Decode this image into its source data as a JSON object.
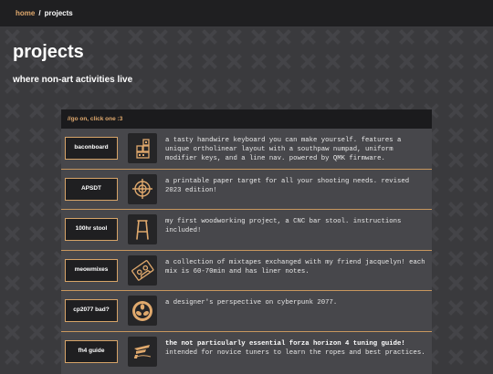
{
  "breadcrumb": {
    "home": "home",
    "separator": "/",
    "current": "projects"
  },
  "header": {
    "title": "projects",
    "subtitle": "where non-art activities live"
  },
  "panel": {
    "header": "//go on, click one :3",
    "projects": [
      {
        "label": "baconboard",
        "icon": "keyboard-keycaps-icon",
        "title": "",
        "description": "a tasty handwire keyboard you can make yourself. features a unique ortholinear layout with a southpaw numpad, uniform modifier keys, and a line nav. powered by QMK firmware."
      },
      {
        "label": "APSDT",
        "icon": "crosshair-target-icon",
        "title": "",
        "description": "a printable paper target for all your shooting needs. revised 2023 edition!"
      },
      {
        "label": "100hr stool",
        "icon": "bar-stool-icon",
        "title": "",
        "description": "my first woodworking project, a CNC bar stool. instructions included!"
      },
      {
        "label": "meowmixes",
        "icon": "cassette-tape-icon",
        "title": "",
        "description": "a collection of mixtapes exchanged with my friend jacquelyn! each mix is 60-70min and has liner notes."
      },
      {
        "label": "cp2077 bad?",
        "icon": "arasaka-logo-icon",
        "title": "",
        "description": "a designer's perspective on cyberpunk 2077."
      },
      {
        "label": "fh4 guide",
        "icon": "forza-horizon-logo-icon",
        "title": "the not particularly essential forza horizon 4 tuning guide!",
        "description": "intended for novice tuners to learn the ropes and best practices."
      }
    ]
  },
  "colors": {
    "accent": "#e0a96d",
    "background": "#3a3a3d",
    "panel": "#47474b",
    "bar": "#1f1f21"
  }
}
